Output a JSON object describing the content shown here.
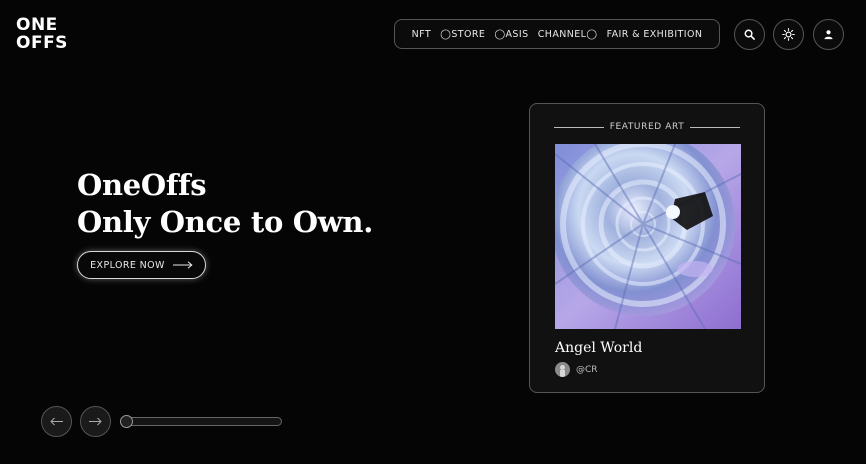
{
  "brand": {
    "line1": "ONE",
    "line2": "OFFS"
  },
  "nav": {
    "items": [
      "NFT",
      "◯STORE",
      "◯ASIS",
      "CHANNEL◯",
      "FAIR & EXHIBITION"
    ]
  },
  "header_icons": [
    "search-icon",
    "sun-icon",
    "user-icon"
  ],
  "hero": {
    "title_line1": "OneOffs",
    "title_line2": "Only Once to Own.",
    "cta_label": "EXPLORE NOW"
  },
  "carousel": {
    "progress": 0.0
  },
  "featured": {
    "header": "FEATURED ART",
    "title": "Angel World",
    "artist": "@CR"
  },
  "colors": {
    "background": "#050505",
    "border": "#555555",
    "text": "#ffffff"
  }
}
